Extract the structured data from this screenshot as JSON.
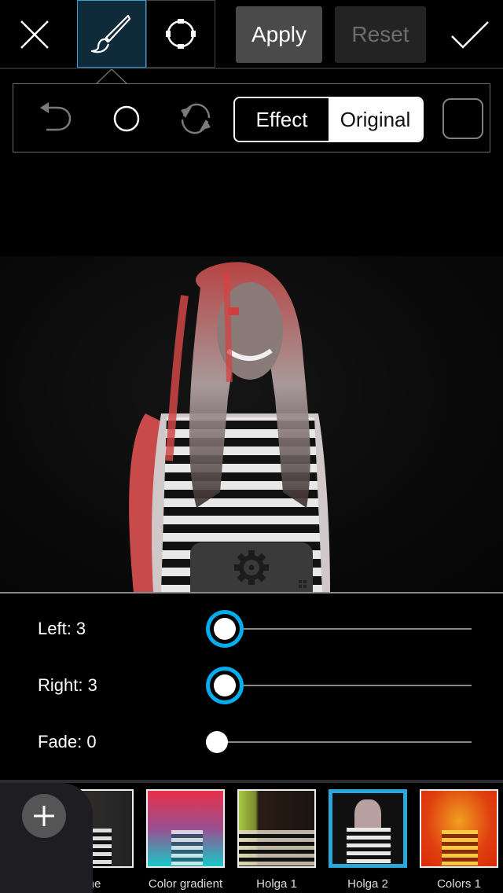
{
  "toolbar": {
    "close_icon": "close-icon",
    "brush_tool": {
      "icon": "brush-icon",
      "active": true
    },
    "shape_tool": {
      "icon": "circle-handles-icon",
      "active": false
    },
    "apply_label": "Apply",
    "reset_label": "Reset",
    "confirm_icon": "checkmark-icon"
  },
  "subtoolbar": {
    "undo_icon": "undo-icon",
    "brush_size_icon": "circle-icon",
    "invert_icon": "refresh-icon",
    "segment": {
      "options": [
        "Effect",
        "Original"
      ],
      "selected": "Original"
    },
    "color_swatch_icon": "square-icon"
  },
  "canvas": {
    "settings_icon": "gear-icon",
    "grip_icon": "grip-icon"
  },
  "sliders": [
    {
      "label": "Left: 3",
      "name": "Left",
      "value": 3,
      "fraction": 0.03,
      "active": true
    },
    {
      "label": "Right: 3",
      "name": "Right",
      "value": 3,
      "fraction": 0.03,
      "active": true
    },
    {
      "label": "Fade: 0",
      "name": "Fade",
      "value": 0,
      "fraction": 0.0,
      "active": false
    }
  ],
  "effects": {
    "add_icon": "plus-icon",
    "items": [
      {
        "label": "ne",
        "style": "tone",
        "selected": false
      },
      {
        "label": "Color gradient",
        "style": "gradient",
        "selected": false
      },
      {
        "label": "Holga 1",
        "style": "holga1",
        "selected": false
      },
      {
        "label": "Holga 2",
        "style": "holga2",
        "selected": true
      },
      {
        "label": "Colors 1",
        "style": "colors",
        "selected": false
      }
    ]
  },
  "colors": {
    "accent": "#2aa8dc",
    "slider_active_ring": "#00aeef",
    "apply_bg": "#4a4a4a",
    "reset_bg": "#232323"
  }
}
